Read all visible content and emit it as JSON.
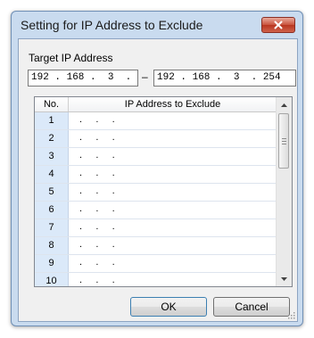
{
  "window": {
    "title": "Setting for IP Address to Exclude"
  },
  "target": {
    "label": "Target IP Address",
    "from": "192 . 168 .  3  .  1",
    "separator": "–",
    "to": "192 . 168 .  3  . 254"
  },
  "table": {
    "col_no": "No.",
    "col_ip": "IP Address to Exclude",
    "rows": [
      {
        "no": "1",
        "ip": ".     .     ."
      },
      {
        "no": "2",
        "ip": ".     .     ."
      },
      {
        "no": "3",
        "ip": ".     .     ."
      },
      {
        "no": "4",
        "ip": ".     .     ."
      },
      {
        "no": "5",
        "ip": ".     .     ."
      },
      {
        "no": "6",
        "ip": ".     .     ."
      },
      {
        "no": "7",
        "ip": ".     .     ."
      },
      {
        "no": "8",
        "ip": ".     .     ."
      },
      {
        "no": "9",
        "ip": ".     .     ."
      },
      {
        "no": "10",
        "ip": ".     .     ."
      }
    ]
  },
  "buttons": {
    "ok": "OK",
    "cancel": "Cancel"
  },
  "icons": {
    "close": "close-icon",
    "scroll_up": "arrow-up-icon",
    "scroll_down": "arrow-down-icon",
    "resize": "resize-grip-icon"
  }
}
